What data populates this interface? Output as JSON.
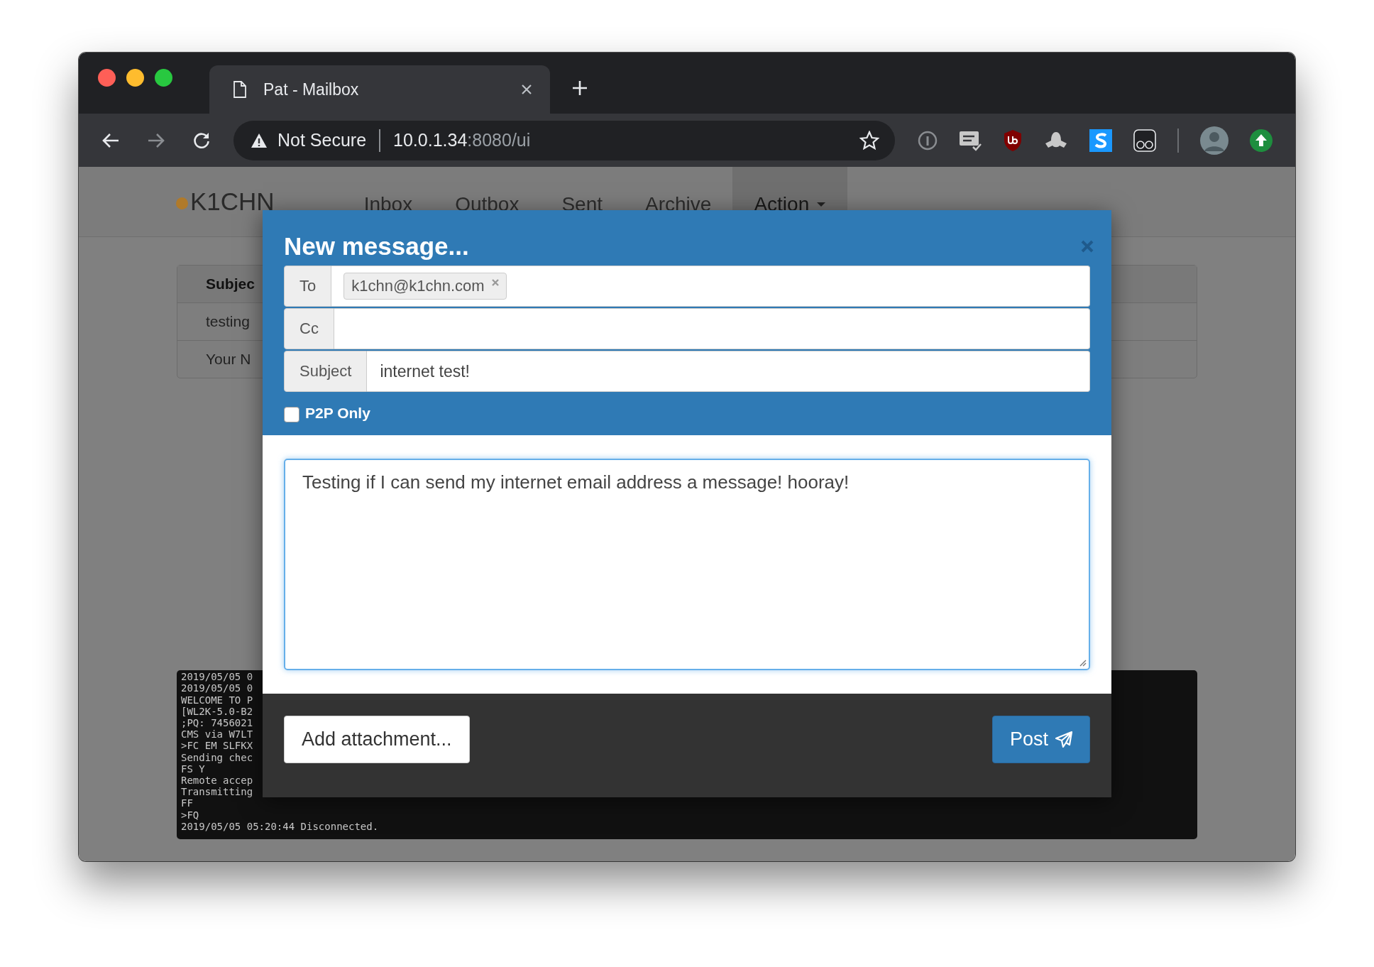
{
  "browser": {
    "tab": {
      "title": "Pat - Mailbox"
    },
    "address": {
      "security": "Not Secure",
      "host": "10.0.1.34",
      "path": ":8080/ui"
    }
  },
  "navbar": {
    "brand": "K1CHN",
    "items": [
      {
        "label": "Inbox",
        "kind": "link",
        "selected": false
      },
      {
        "label": "Outbox",
        "kind": "link",
        "selected": false
      },
      {
        "label": "Sent",
        "kind": "link",
        "selected": false
      },
      {
        "label": "Archive",
        "kind": "link",
        "selected": false
      },
      {
        "label": "Action",
        "kind": "dropdown",
        "selected": true
      }
    ]
  },
  "messages_table": {
    "columns": [
      "Subjec"
    ],
    "rows": [
      [
        "testing"
      ],
      [
        "Your N"
      ]
    ]
  },
  "terminal": {
    "lines": [
      "2019/05/05 0",
      "2019/05/05 0",
      "WELCOME TO P",
      "[WL2K-5.0-B2",
      ";PQ: 7456021",
      "CMS via W7LT",
      ">FC EM SLFKX",
      "Sending chec",
      "FS Y",
      "Remote accep",
      "Transmitting",
      "FF",
      ">FQ",
      "2019/05/05 05:20:44 Disconnected."
    ]
  },
  "modal": {
    "title": "New message...",
    "fields": [
      {
        "label": "To",
        "kind": "tokens",
        "tokens": [
          "k1chn@k1chn.com"
        ]
      },
      {
        "label": "Cc",
        "kind": "tokens"
      },
      {
        "label": "Subject",
        "kind": "text",
        "value": "internet test!"
      }
    ],
    "p2p_only": {
      "label": "P2P Only",
      "checked": false
    },
    "body": "Testing if I can send my internet email address a message! hooray!",
    "buttons": [
      {
        "label": "Add attachment...",
        "kind": "default"
      },
      {
        "label": "Post",
        "kind": "primary"
      }
    ]
  }
}
